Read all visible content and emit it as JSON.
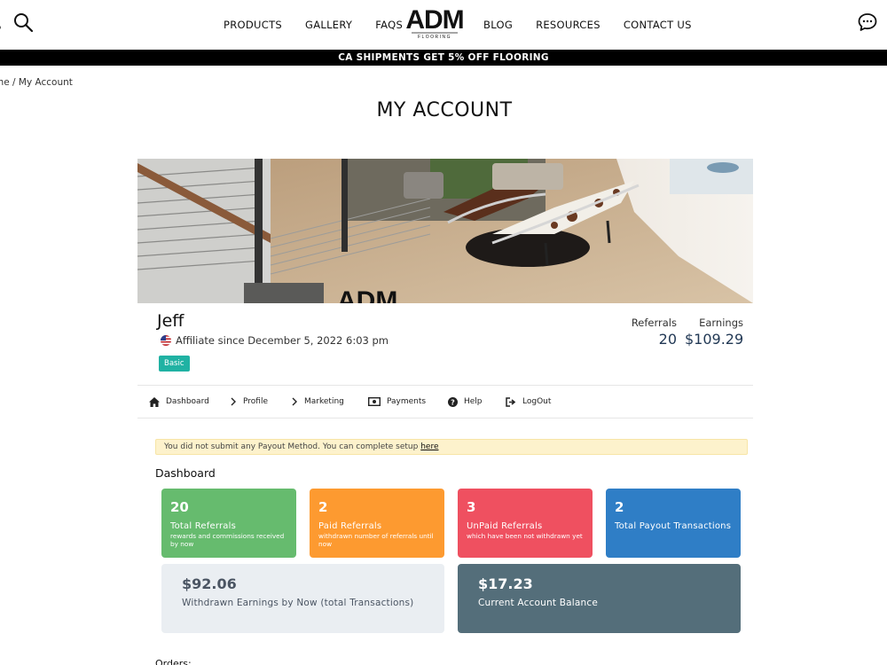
{
  "header": {
    "nav_left": [
      "PRODUCTS",
      "GALLERY",
      "FAQS"
    ],
    "nav_right": [
      "BLOG",
      "RESOURCES",
      "CONTACT US"
    ],
    "logo_text": "ADM",
    "logo_sub": "FLOORING"
  },
  "promo": "CA SHIPMENTS GET 5% OFF FLOORING",
  "breadcrumb": "me / My Account",
  "page_title": "MY ACCOUNT",
  "profile": {
    "name": "Jeff",
    "since": "Affiliate since December 5, 2022 6:03 pm",
    "badge": "Basic",
    "referrals_label": "Referrals",
    "referrals_value": "20",
    "earnings_label": "Earnings",
    "earnings_value": "$109.29"
  },
  "tabs": [
    "Dashboard",
    "Profile",
    "Marketing",
    "Payments",
    "Help",
    "LogOut"
  ],
  "notice": {
    "text": "You did not submit any Payout Method. You can complete setup ",
    "link": "here"
  },
  "dashboard": {
    "title": "Dashboard",
    "cards": [
      {
        "num": "20",
        "label": "Total Referrals",
        "sub": "rewards and commissions received by now",
        "color": "#66bb6e"
      },
      {
        "num": "2",
        "label": "Paid Referrals",
        "sub": "withdrawn number of referrals until now",
        "color": "#fd9a30"
      },
      {
        "num": "3",
        "label": "UnPaid Referrals",
        "sub": "which have been not withdrawn yet",
        "color": "#ef5060"
      },
      {
        "num": "2",
        "label": "Total Payout Transactions",
        "sub": "",
        "color": "#2f7ec6"
      }
    ],
    "withdrawn": {
      "num": "$92.06",
      "label": "Withdrawn Earnings by Now (total Transactions)"
    },
    "balance": {
      "num": "$17.23",
      "label": "Current Account Balance"
    }
  },
  "orders_label": "Orders:"
}
